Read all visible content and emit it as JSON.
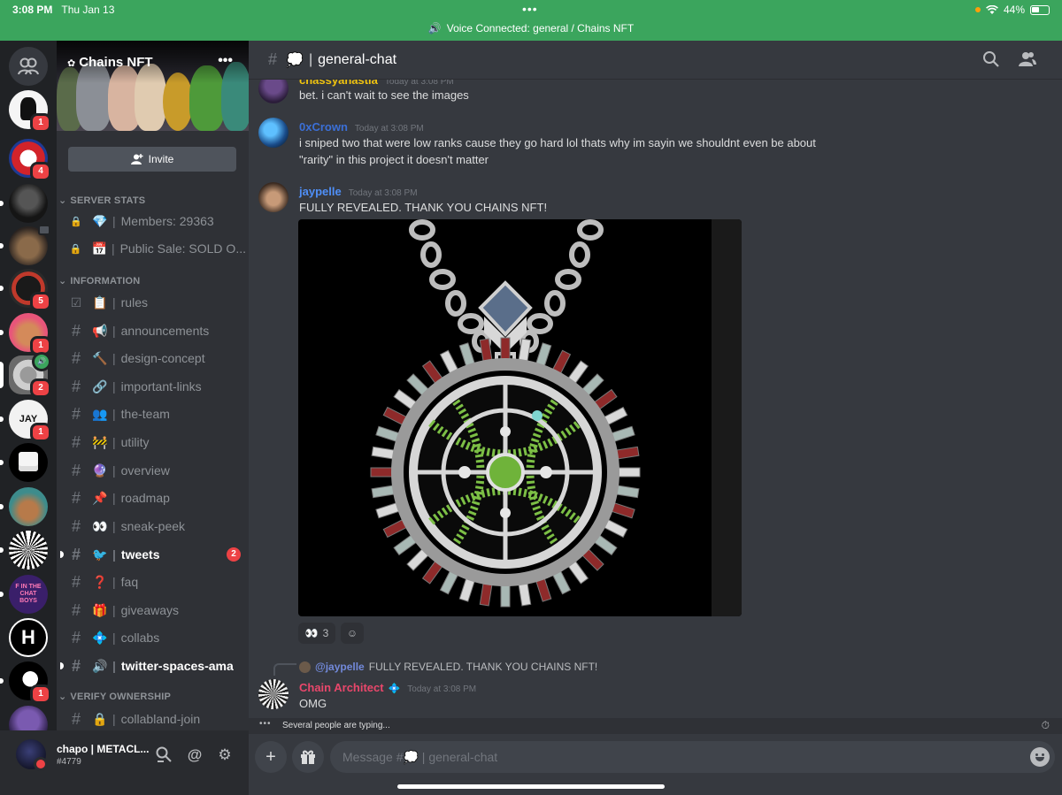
{
  "statusbar": {
    "time": "3:08 PM",
    "date": "Thu Jan 13",
    "battery": "44%"
  },
  "voice_banner": {
    "text": "Voice Connected: general / Chains NFT"
  },
  "server": {
    "name": "Chains NFT",
    "invite_label": "Invite"
  },
  "rail": {
    "servers": [
      {
        "badge": "1"
      },
      {
        "badge": "4"
      },
      {
        "badge": ""
      },
      {
        "badge": ""
      },
      {
        "badge": "5"
      },
      {
        "badge": "1"
      },
      {
        "badge": "2"
      },
      {
        "badge": "1"
      },
      {
        "badge": ""
      },
      {
        "badge": ""
      },
      {
        "badge": ""
      },
      {
        "badge": ""
      },
      {
        "badge": ""
      },
      {
        "badge": "1"
      },
      {
        "badge": ""
      }
    ],
    "text_icons": {
      "jay": "JAY",
      "fthechat": "F IN THE CHAT BOYS",
      "h": "H"
    }
  },
  "categories": {
    "server_stats": "SERVER STATS",
    "information": "INFORMATION",
    "verify": "VERIFY OWNERSHIP"
  },
  "channels": {
    "stats": [
      {
        "emoji": "💎",
        "name": "Members: 29363"
      },
      {
        "emoji": "📅",
        "name": "Public Sale: SOLD O..."
      }
    ],
    "info": [
      {
        "emoji": "📋",
        "name": "rules"
      },
      {
        "emoji": "📢",
        "name": "announcements"
      },
      {
        "emoji": "🔨",
        "name": "design-concept"
      },
      {
        "emoji": "🔗",
        "name": "important-links"
      },
      {
        "emoji": "👥",
        "name": "the-team"
      },
      {
        "emoji": "🚧",
        "name": "utility"
      },
      {
        "emoji": "🔮",
        "name": "overview"
      },
      {
        "emoji": "📌",
        "name": "roadmap"
      },
      {
        "emoji": "👀",
        "name": "sneak-peek"
      },
      {
        "emoji": "🐦",
        "name": "tweets",
        "badge": "2"
      },
      {
        "emoji": "❓",
        "name": "faq"
      },
      {
        "emoji": "🎁",
        "name": "giveaways"
      },
      {
        "emoji": "💠",
        "name": "collabs"
      },
      {
        "emoji": "🔊",
        "name": "twitter-spaces-ama"
      }
    ],
    "verify": [
      {
        "emoji": "🔒",
        "name": "collabland-join"
      }
    ]
  },
  "user": {
    "name": "chapo | METACL...",
    "tag": "#4779"
  },
  "header": {
    "channel": "general-chat",
    "emoji": "💭"
  },
  "messages": [
    {
      "author": "chassyanastia",
      "time": "Today at 3:08 PM",
      "text": "bet. i can't wait to see the images",
      "color": "#f1c40f"
    },
    {
      "author": "0xCrown",
      "time": "Today at 3:08 PM",
      "text": "i sniped two that were low ranks cause they go hard lol thats why im sayin we shouldnt even be about \"rarity\" in this project it doesn't matter",
      "color": "#3b6fd6"
    },
    {
      "author": "jaypelle",
      "time": "Today at 3:08 PM",
      "text": "FULLY REVEALED. THANK YOU CHAINS NFT!",
      "color": "#4f8ff7"
    },
    {
      "author": "Chain Architect",
      "time": "Today at 3:08 PM",
      "text": "OMG",
      "color": "#e9476b"
    }
  ],
  "reactions": [
    {
      "emoji": "👀",
      "count": "3"
    }
  ],
  "reply": {
    "mention": "@jaypelle",
    "text": "FULLY REVEALED. THANK YOU CHAINS NFT!"
  },
  "typing": "Several people are typing...",
  "composer": {
    "placeholder": "Message #💭 | general-chat"
  }
}
